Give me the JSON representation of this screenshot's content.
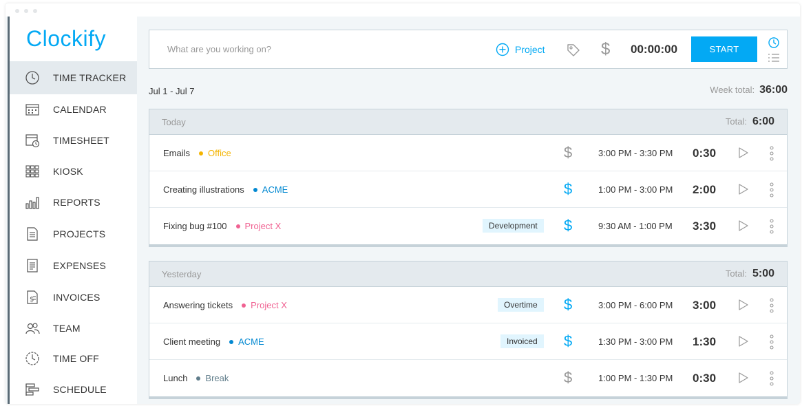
{
  "app": {
    "logo_prefix": "C",
    "logo_rest": "lockify"
  },
  "sidebar": {
    "items": [
      {
        "label": "TIME TRACKER",
        "icon": "clock-icon",
        "active": true
      },
      {
        "label": "CALENDAR",
        "icon": "calendar-icon"
      },
      {
        "label": "TIMESHEET",
        "icon": "timesheet-icon"
      },
      {
        "label": "KIOSK",
        "icon": "kiosk-grid-icon"
      },
      {
        "label": "REPORTS",
        "icon": "bar-chart-icon"
      },
      {
        "label": "PROJECTS",
        "icon": "document-icon"
      },
      {
        "label": "EXPENSES",
        "icon": "receipt-icon"
      },
      {
        "label": "INVOICES",
        "icon": "invoice-icon"
      },
      {
        "label": "TEAM",
        "icon": "team-icon"
      },
      {
        "label": "TIME OFF",
        "icon": "time-off-icon"
      },
      {
        "label": "SCHEDULE",
        "icon": "schedule-icon"
      }
    ]
  },
  "tracker": {
    "placeholder": "What are you working on?",
    "project_label": "Project",
    "timer": "00:00:00",
    "start_label": "START"
  },
  "week": {
    "range": "Jul 1 - Jul 7",
    "total_label": "Week total:",
    "total": "36:00"
  },
  "groups": [
    {
      "label": "Today",
      "total_label": "Total:",
      "total": "6:00",
      "entries": [
        {
          "description": "Emails",
          "project": "Office",
          "project_color": "#f4b400",
          "tag": "",
          "billable": false,
          "time_range": "3:00 PM - 3:30 PM",
          "duration": "0:30"
        },
        {
          "description": "Creating illustrations",
          "project": "ACME",
          "project_color": "#0288d1",
          "tag": "",
          "billable": true,
          "time_range": "1:00 PM - 3:00 PM",
          "duration": "2:00"
        },
        {
          "description": "Fixing bug #100",
          "project": "Project X",
          "project_color": "#f06292",
          "tag": "Development",
          "billable": true,
          "time_range": "9:30 AM - 1:00 PM",
          "duration": "3:30"
        }
      ]
    },
    {
      "label": "Yesterday",
      "total_label": "Total:",
      "total": "5:00",
      "entries": [
        {
          "description": "Answering tickets",
          "project": "Project X",
          "project_color": "#f06292",
          "tag": "Overtime",
          "billable": true,
          "time_range": "3:00 PM - 6:00 PM",
          "duration": "3:00"
        },
        {
          "description": "Client meeting",
          "project": "ACME",
          "project_color": "#0288d1",
          "tag": "Invoiced",
          "billable": true,
          "time_range": "1:30 PM - 3:00 PM",
          "duration": "1:30"
        },
        {
          "description": "Lunch",
          "project": "Break",
          "project_color": "#607d8b",
          "tag": "",
          "billable": false,
          "time_range": "1:00 PM - 1:30 PM",
          "duration": "0:30"
        }
      ]
    }
  ],
  "colors": {
    "accent": "#03a9f4",
    "billable_on": "#03a9f4",
    "billable_off": "#999999"
  }
}
